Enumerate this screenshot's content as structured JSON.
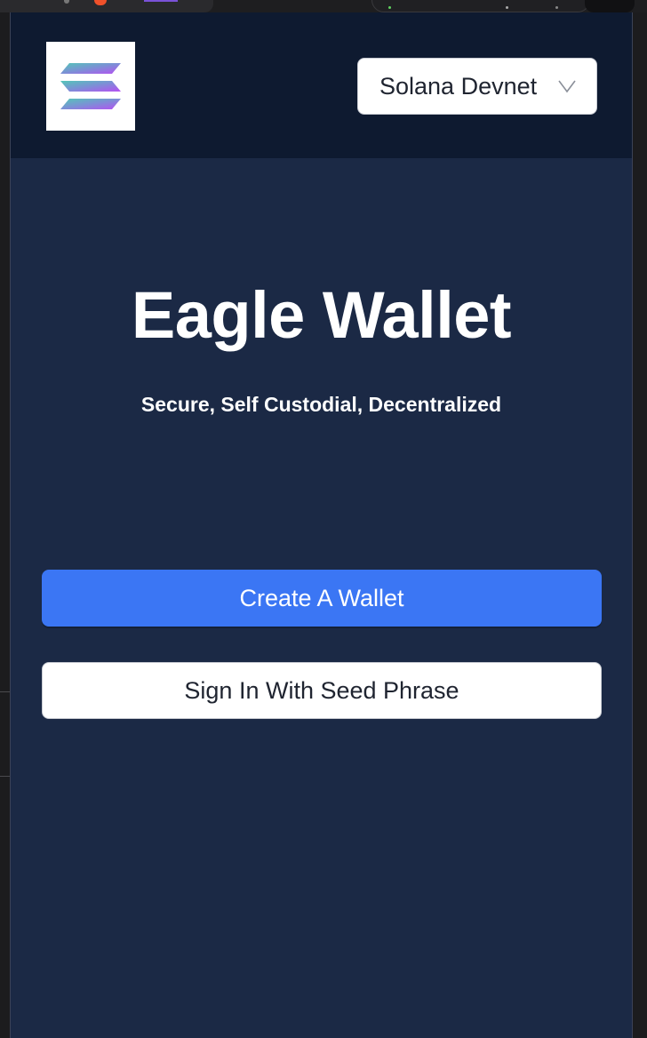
{
  "header": {
    "logo_icon": "solana-logo-icon",
    "network_select": {
      "selected": "Solana Devnet",
      "icon": "chevron-down-icon"
    }
  },
  "main": {
    "title": "Eagle Wallet",
    "tagline": "Secure, Self Custodial, Decentralized",
    "create_button_label": "Create A Wallet",
    "signin_button_label": "Sign In With Seed Phrase"
  },
  "colors": {
    "header_bg": "#0e1a30",
    "page_bg": "#1b2945",
    "primary_button": "#3b76f4",
    "text_light": "#ffffff"
  }
}
